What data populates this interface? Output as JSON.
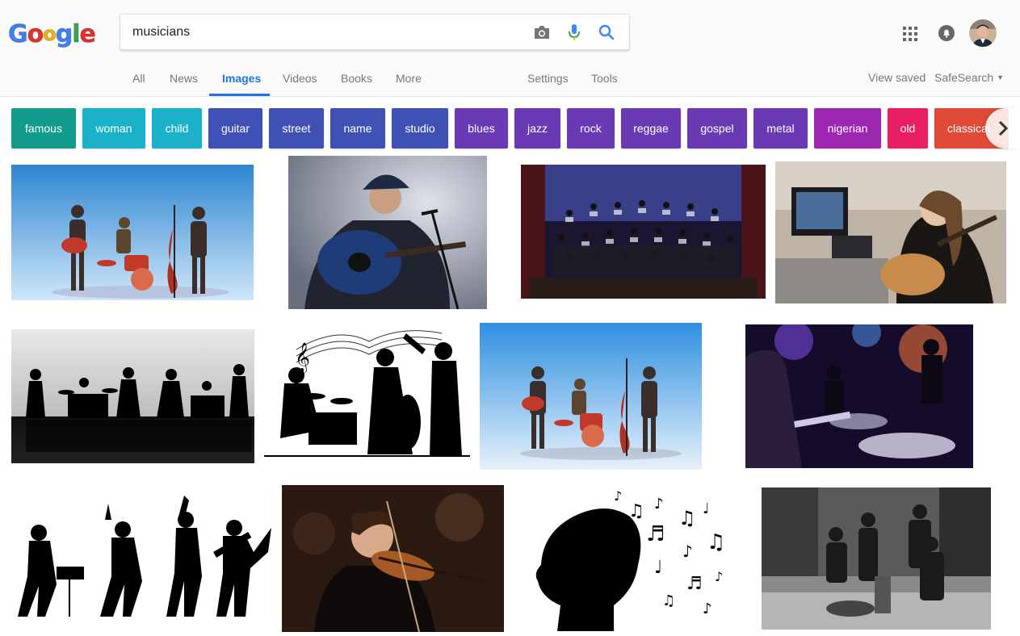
{
  "logo": {
    "letters": [
      "G",
      "o",
      "o",
      "g",
      "l",
      "e"
    ],
    "colors": [
      "#3b82f6",
      "#e4322b",
      "#f5b400",
      "#3b82f6",
      "#34a853",
      "#e4322b"
    ]
  },
  "search": {
    "query": "musicians"
  },
  "icons": {
    "camera": "camera-icon",
    "mic": "mic-icon",
    "search": "search-icon",
    "apps": "apps-grid-icon",
    "notifications": "notifications-icon",
    "chevron": "chevron-right-icon",
    "dropdown": "caret-down-icon"
  },
  "nav": {
    "tabs": [
      "All",
      "News",
      "Images",
      "Videos",
      "Books",
      "More"
    ],
    "active": "Images",
    "settings": "Settings",
    "tools": "Tools",
    "view_saved": "View saved",
    "safesearch": "SafeSearch"
  },
  "chips": [
    {
      "label": "famous",
      "color": "#139b8b"
    },
    {
      "label": "woman",
      "color": "#1bb2c9"
    },
    {
      "label": "child",
      "color": "#1bb2c9"
    },
    {
      "label": "guitar",
      "color": "#3f51b5"
    },
    {
      "label": "street",
      "color": "#3f51b5"
    },
    {
      "label": "name",
      "color": "#3f51b5"
    },
    {
      "label": "studio",
      "color": "#3f51b5"
    },
    {
      "label": "blues",
      "color": "#6a3ab5"
    },
    {
      "label": "jazz",
      "color": "#6a3ab5"
    },
    {
      "label": "rock",
      "color": "#6a3ab5"
    },
    {
      "label": "reggae",
      "color": "#6a3ab5"
    },
    {
      "label": "gospel",
      "color": "#6a3ab5"
    },
    {
      "label": "metal",
      "color": "#6a3ab5"
    },
    {
      "label": "nigerian",
      "color": "#9c27b0"
    },
    {
      "label": "old",
      "color": "#e91e63"
    },
    {
      "label": "classical",
      "color": "#e04a36"
    }
  ],
  "accent": "#1a73e8"
}
